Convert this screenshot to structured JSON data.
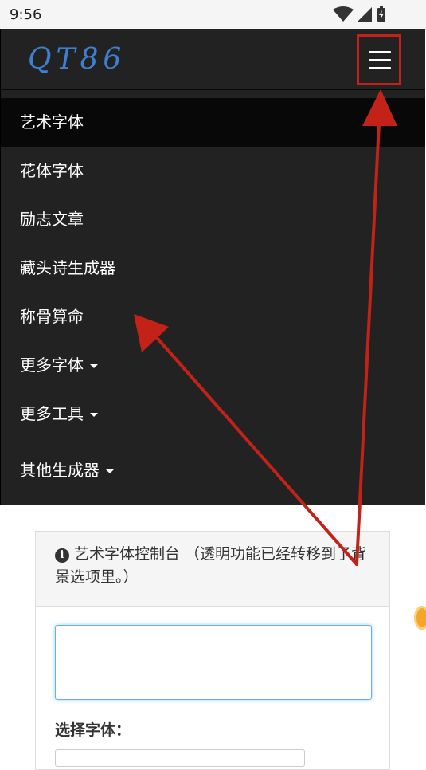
{
  "status_bar": {
    "time": "9:56"
  },
  "navbar": {
    "logo": "QT86"
  },
  "menu": {
    "items": [
      {
        "label": "艺术字体",
        "active": true,
        "dropdown": false
      },
      {
        "label": "花体字体",
        "active": false,
        "dropdown": false
      },
      {
        "label": "励志文章",
        "active": false,
        "dropdown": false
      },
      {
        "label": "藏头诗生成器",
        "active": false,
        "dropdown": false
      },
      {
        "label": "称骨算命",
        "active": false,
        "dropdown": false
      },
      {
        "label": "更多字体",
        "active": false,
        "dropdown": true
      },
      {
        "label": "更多工具",
        "active": false,
        "dropdown": true
      },
      {
        "label": "其他生成器",
        "active": false,
        "dropdown": true
      }
    ]
  },
  "panel": {
    "heading": "艺术字体控制台 （透明功能已经转移到了背景选项里。）",
    "font_label": "选择字体："
  },
  "colors": {
    "navbar_bg": "#222222",
    "active_item_bg": "#080808",
    "logo": "#3f7fd0",
    "annotation_red": "#c22218"
  }
}
